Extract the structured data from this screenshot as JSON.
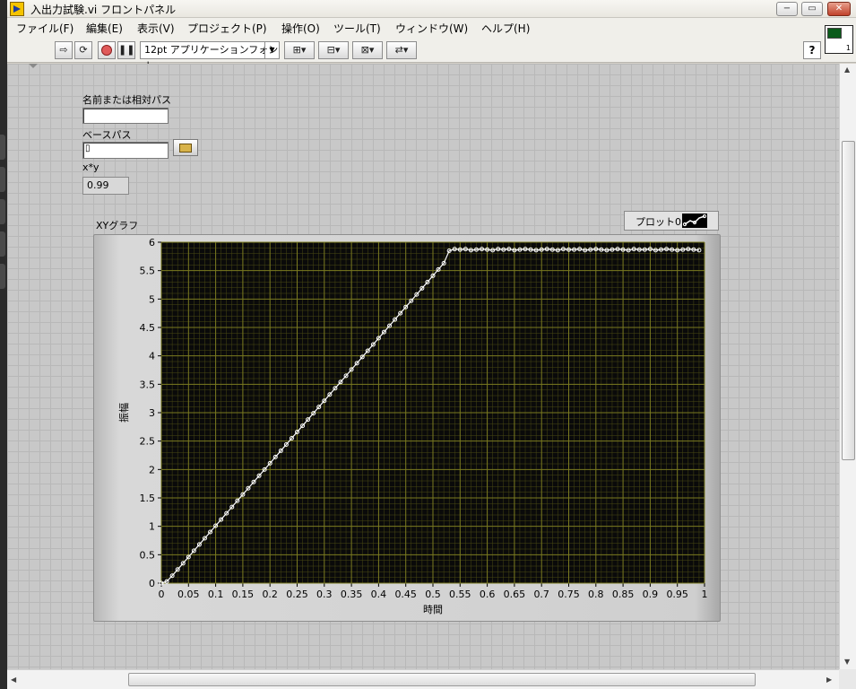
{
  "window": {
    "title": "入出力試験.vi フロントパネル",
    "min_label": "−",
    "restore_label": "▭",
    "close_label": "✕"
  },
  "menu": [
    "ファイル(F)",
    "編集(E)",
    "表示(V)",
    "プロジェクト(P)",
    "操作(O)",
    "ツール(T)",
    "ウィンドウ(W)",
    "ヘルプ(H)"
  ],
  "toolbar": {
    "run_icon": "run-arrow-icon",
    "run_continuous_icon": "run-continuous-icon",
    "abort_icon": "abort-icon",
    "pause_icon": "pause-icon",
    "font": "12pt アプリケーションフォント",
    "align_icon": "align-objects-icon",
    "distribute_icon": "distribute-objects-icon",
    "resize_icon": "resize-objects-icon",
    "reorder_icon": "reorder-icon",
    "help_label": "?"
  },
  "controls": {
    "name_label": "名前または相対パス",
    "name_value": "",
    "base_path_label": "ベースパス",
    "base_path_value": "",
    "xy_label": "x*y",
    "xy_value": "0.99"
  },
  "legend": {
    "plot_name": "プロット0"
  },
  "chart_data": {
    "type": "line",
    "title": "XYグラフ",
    "xlabel": "時間",
    "ylabel": "振幅",
    "xlim": [
      0,
      1
    ],
    "ylim": [
      0,
      6
    ],
    "x_ticks": [
      "0",
      "0.05",
      "0.1",
      "0.15",
      "0.2",
      "0.25",
      "0.3",
      "0.35",
      "0.4",
      "0.45",
      "0.5",
      "0.55",
      "0.6",
      "0.65",
      "0.7",
      "0.75",
      "0.8",
      "0.85",
      "0.9",
      "0.95",
      "1"
    ],
    "y_ticks": [
      "0",
      "0.5",
      "1",
      "1.5",
      "2",
      "2.5",
      "3",
      "3.5",
      "4",
      "4.5",
      "5",
      "5.5",
      "6"
    ],
    "grid": true,
    "background": "#0a0a0a",
    "grid_color": "#7a7a20",
    "series": [
      {
        "name": "プロット0",
        "color": "#ffffff",
        "marker": "circle",
        "x": [
          0,
          0.01,
          0.02,
          0.03,
          0.04,
          0.05,
          0.06,
          0.07,
          0.08,
          0.09,
          0.1,
          0.11,
          0.12,
          0.13,
          0.14,
          0.15,
          0.16,
          0.17,
          0.18,
          0.19,
          0.2,
          0.21,
          0.22,
          0.23,
          0.24,
          0.25,
          0.26,
          0.27,
          0.28,
          0.29,
          0.3,
          0.31,
          0.32,
          0.33,
          0.34,
          0.35,
          0.36,
          0.37,
          0.38,
          0.39,
          0.4,
          0.41,
          0.42,
          0.43,
          0.44,
          0.45,
          0.46,
          0.47,
          0.48,
          0.49,
          0.5,
          0.51,
          0.52,
          0.53,
          0.54,
          0.55,
          0.56,
          0.57,
          0.58,
          0.59,
          0.6,
          0.61,
          0.62,
          0.63,
          0.64,
          0.65,
          0.66,
          0.67,
          0.68,
          0.69,
          0.7,
          0.71,
          0.72,
          0.73,
          0.74,
          0.75,
          0.76,
          0.77,
          0.78,
          0.79,
          0.8,
          0.81,
          0.82,
          0.83,
          0.84,
          0.85,
          0.86,
          0.87,
          0.88,
          0.89,
          0.9,
          0.91,
          0.92,
          0.93,
          0.94,
          0.95,
          0.96,
          0.97,
          0.98,
          0.99
        ],
        "y": [
          0,
          0.03,
          0.13,
          0.24,
          0.35,
          0.46,
          0.57,
          0.68,
          0.79,
          0.9,
          1.01,
          1.12,
          1.23,
          1.34,
          1.45,
          1.56,
          1.67,
          1.78,
          1.89,
          2.0,
          2.11,
          2.22,
          2.33,
          2.44,
          2.55,
          2.66,
          2.77,
          2.88,
          2.99,
          3.1,
          3.21,
          3.32,
          3.43,
          3.54,
          3.65,
          3.76,
          3.87,
          3.98,
          4.09,
          4.2,
          4.31,
          4.42,
          4.53,
          4.64,
          4.75,
          4.86,
          4.97,
          5.08,
          5.19,
          5.3,
          5.41,
          5.52,
          5.63,
          5.85,
          5.88,
          5.87,
          5.88,
          5.86,
          5.87,
          5.88,
          5.87,
          5.86,
          5.88,
          5.87,
          5.88,
          5.86,
          5.87,
          5.88,
          5.87,
          5.86,
          5.87,
          5.88,
          5.87,
          5.86,
          5.88,
          5.87,
          5.87,
          5.88,
          5.86,
          5.87,
          5.88,
          5.87,
          5.86,
          5.87,
          5.88,
          5.87,
          5.86,
          5.88,
          5.87,
          5.87,
          5.88,
          5.86,
          5.87,
          5.88,
          5.87,
          5.86,
          5.87,
          5.88,
          5.87,
          5.86
        ]
      }
    ]
  }
}
